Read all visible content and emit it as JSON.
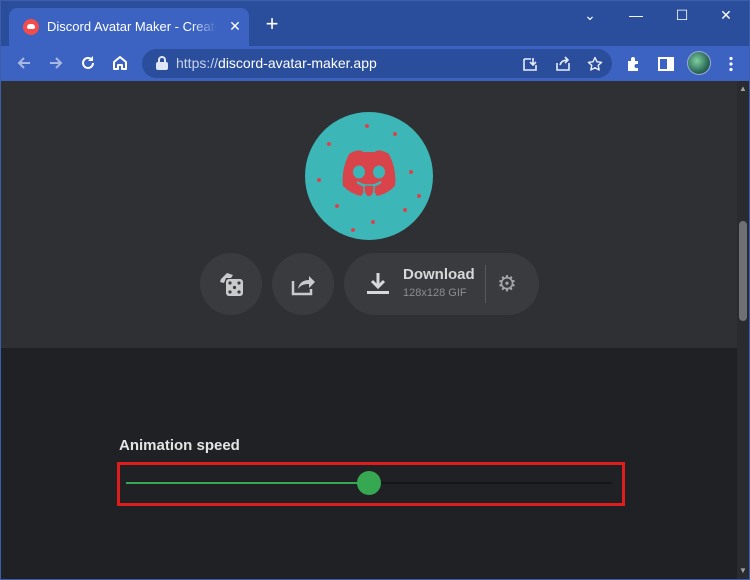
{
  "browser": {
    "tab_title": "Discord Avatar Maker - Create your",
    "tab_close": "✕",
    "new_tab": "+",
    "window_controls": {
      "chevron": "⌄",
      "minimize": "—",
      "maximize": "☐",
      "close": "✕"
    },
    "url_scheme": "https://",
    "url_host": "discord-avatar-maker.app",
    "icons": [
      "back-arrow-icon",
      "forward-arrow-icon",
      "reload-icon",
      "home-icon",
      "lock-icon",
      "install-app-icon",
      "share-icon",
      "star-icon",
      "extensions-icon",
      "side-panel-icon",
      "profile-avatar-icon",
      "kebab-menu-icon"
    ]
  },
  "editor": {
    "avatar_colors": {
      "background": "#3cb6b7",
      "mascot": "#d9434a"
    },
    "buttons": {
      "randomize_icon": "dice-icon",
      "share_icon": "share-arrow-icon",
      "download_label": "Download",
      "download_format": "128x128 GIF",
      "settings_icon": "gear-icon"
    }
  },
  "animation": {
    "label": "Animation speed",
    "slider_value": 0.5,
    "accent_color": "#36a852",
    "highlight_color": "#e01d1d"
  }
}
